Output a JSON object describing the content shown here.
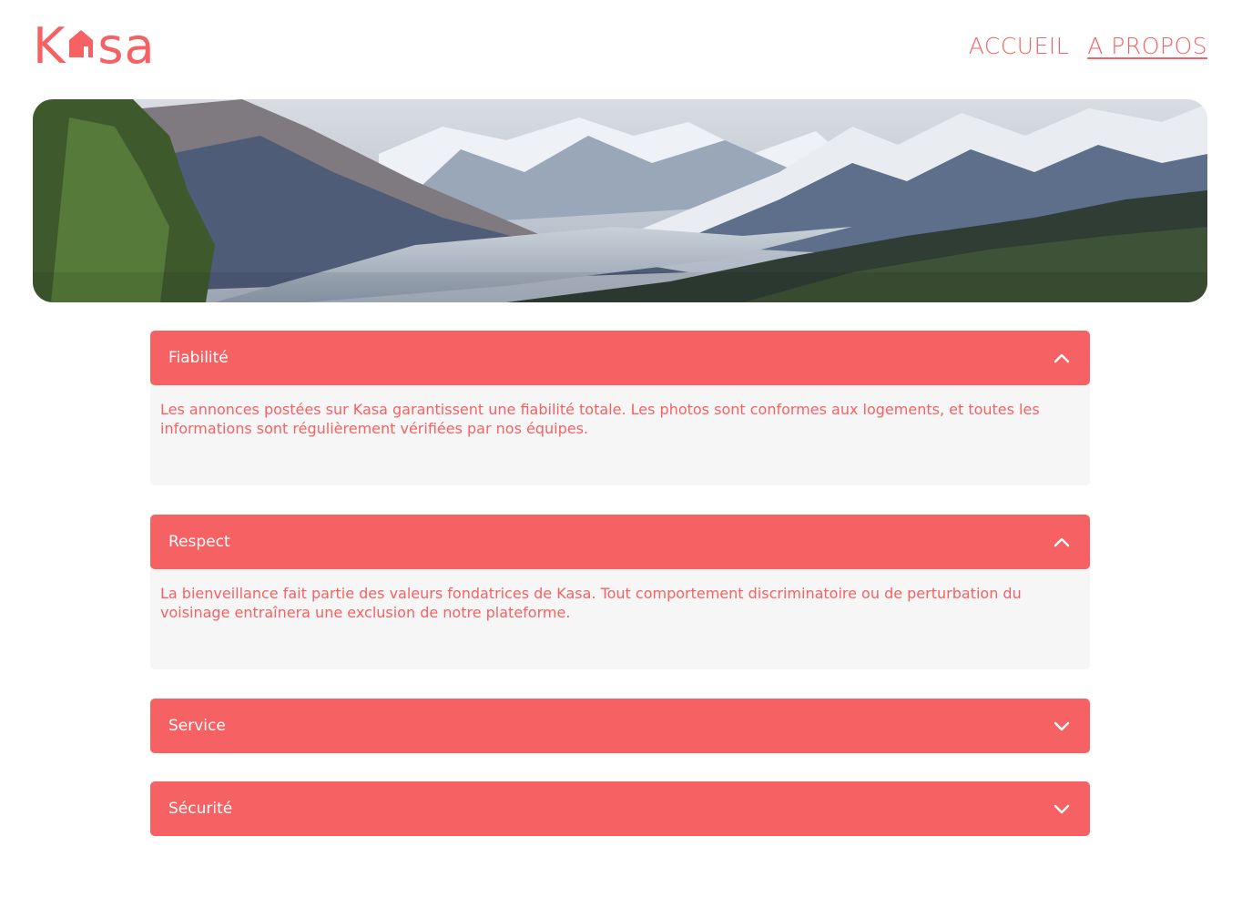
{
  "brand": {
    "logo_text_left": "K",
    "logo_text_right": "sa",
    "accent_color": "#F66163"
  },
  "nav": {
    "items": [
      {
        "label": "ACCUEIL",
        "active": false
      },
      {
        "label": "A PROPOS",
        "active": true
      }
    ]
  },
  "banner": {
    "image": "mountain-valley-landscape"
  },
  "collapses": [
    {
      "title": "Fiabilité",
      "open": true,
      "icon": "chevron-up-icon",
      "content": "Les annonces postées sur Kasa garantissent une fiabilité totale. Les photos sont conformes aux logements, et toutes les informations sont régulièrement vérifiées par nos équipes."
    },
    {
      "title": "Respect",
      "open": true,
      "icon": "chevron-up-icon",
      "content": "La bienveillance fait partie des valeurs fondatrices de Kasa. Tout comportement discriminatoire ou de perturbation du voisinage entraînera une exclusion de notre plateforme."
    },
    {
      "title": "Service",
      "open": false,
      "icon": "chevron-down-icon"
    },
    {
      "title": "Sécurité",
      "open": false,
      "icon": "chevron-down-icon"
    }
  ]
}
